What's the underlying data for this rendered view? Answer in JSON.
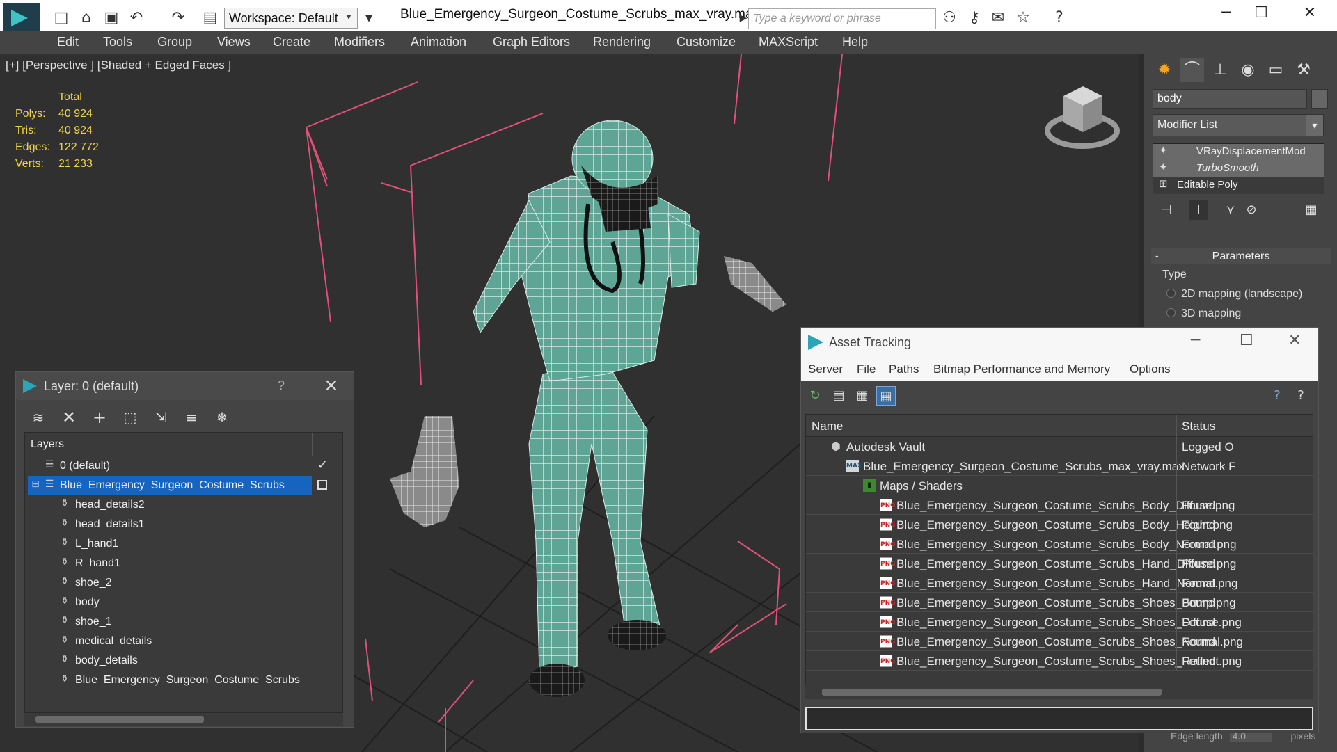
{
  "titlebar": {
    "workspace": "Workspace: Default",
    "title": "Blue_Emergency_Surgeon_Costume_Scrubs_max_vray.max",
    "search_placeholder": "Type a keyword or phrase"
  },
  "menu": [
    "Edit",
    "Tools",
    "Group",
    "Views",
    "Create",
    "Modifiers",
    "Animation",
    "Graph Editors",
    "Rendering",
    "Customize",
    "MAXScript",
    "Help"
  ],
  "viewport": {
    "label": "[+] [Perspective ] [Shaded + Edged Faces ]",
    "stats_header": "Total",
    "stats": [
      {
        "k": "Polys:",
        "v": "40 924"
      },
      {
        "k": "Tris:",
        "v": "40 924"
      },
      {
        "k": "Edges:",
        "v": "122 772"
      },
      {
        "k": "Verts:",
        "v": "21 233"
      }
    ]
  },
  "command_panel": {
    "object_name": "body",
    "modifier_list": "Modifier List",
    "stack": [
      "VRayDisplacementMod",
      "TurboSmooth",
      "Editable Poly"
    ],
    "params_title": "Parameters",
    "type_label": "Type",
    "radio_2d": "2D mapping (landscape)",
    "radio_3d": "3D mapping",
    "edge_length": "Edge length",
    "edge_value": "4.0",
    "edge_unit": "pixels"
  },
  "layer_dialog": {
    "title": "Layer: 0 (default)",
    "help": "?",
    "tree_header": "Layers",
    "layers": [
      {
        "name": "0 (default)"
      },
      {
        "name": "Blue_Emergency_Surgeon_Costume_Scrubs"
      }
    ],
    "objects": [
      "head_details2",
      "head_details1",
      "L_hand1",
      "R_hand1",
      "shoe_2",
      "body",
      "shoe_1",
      "medical_details",
      "body_details",
      "Blue_Emergency_Surgeon_Costume_Scrubs"
    ]
  },
  "asset_tracking": {
    "title": "Asset Tracking",
    "menu": [
      "Server",
      "File",
      "Paths",
      "Bitmap Performance and Memory",
      "Options"
    ],
    "col_name": "Name",
    "col_status": "Status",
    "vault": {
      "name": "Autodesk Vault",
      "status": "Logged O"
    },
    "file": {
      "name": "Blue_Emergency_Surgeon_Costume_Scrubs_max_vray.max",
      "status": "Network F"
    },
    "maps_folder": "Maps / Shaders",
    "maps": [
      {
        "name": "Blue_Emergency_Surgeon_Costume_Scrubs_Body_Diffuse.png",
        "status": "Found"
      },
      {
        "name": "Blue_Emergency_Surgeon_Costume_Scrubs_Body_Height.png",
        "status": "Found"
      },
      {
        "name": "Blue_Emergency_Surgeon_Costume_Scrubs_Body_Normal.png",
        "status": "Found"
      },
      {
        "name": "Blue_Emergency_Surgeon_Costume_Scrubs_Hand_Diffuse.png",
        "status": "Found"
      },
      {
        "name": "Blue_Emergency_Surgeon_Costume_Scrubs_Hand_Normal.png",
        "status": "Found"
      },
      {
        "name": "Blue_Emergency_Surgeon_Costume_Scrubs_Shoes_Bump.png",
        "status": "Found"
      },
      {
        "name": "Blue_Emergency_Surgeon_Costume_Scrubs_Shoes_Diffuse.png",
        "status": "Found"
      },
      {
        "name": "Blue_Emergency_Surgeon_Costume_Scrubs_Shoes_Normal.png",
        "status": "Found"
      },
      {
        "name": "Blue_Emergency_Surgeon_Costume_Scrubs_Shoes_Reflect.png",
        "status": "Found"
      }
    ]
  },
  "colors": {
    "accent": "#1565c0",
    "stats_yellow": "#f0d24a",
    "scrubs_teal": "#5fa596",
    "bbox_pink": "#e0507a"
  }
}
